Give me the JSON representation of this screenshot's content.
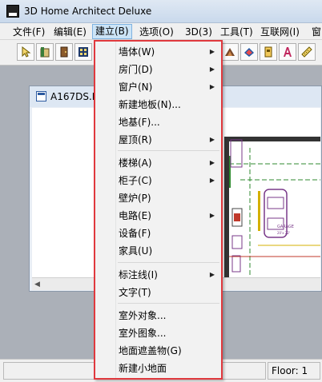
{
  "window": {
    "title": "3D Home Architect Deluxe"
  },
  "menubar": {
    "items": [
      "文件(F)",
      "编辑(E)",
      "建立(B)",
      "选项(O)",
      "3D(3)",
      "工具(T)",
      "互联网(I)",
      "窗"
    ]
  },
  "toolbar": {
    "icons": [
      "pointer-icon",
      "wall-icon",
      "door-icon",
      "window-icon",
      "roof-icon",
      "material-icon",
      "camera-icon",
      "text-icon",
      "ruler-icon"
    ]
  },
  "document": {
    "title": "A167DS.D",
    "plan_labels": {
      "garage": "GARAGE",
      "garage_size": "20'x 22'"
    }
  },
  "build_menu": {
    "items": [
      {
        "label": "墙体(W)",
        "submenu": true
      },
      {
        "label": "房门(D)",
        "submenu": true
      },
      {
        "label": "窗户(N)",
        "submenu": true
      },
      {
        "label": "新建地板(N)...",
        "submenu": false
      },
      {
        "label": "地基(F)...",
        "submenu": false
      },
      {
        "label": "屋顶(R)",
        "submenu": true
      },
      {
        "label": "楼梯(A)",
        "submenu": true
      },
      {
        "label": "柜子(C)",
        "submenu": true
      },
      {
        "label": "壁炉(P)",
        "submenu": false
      },
      {
        "label": "电路(E)",
        "submenu": true
      },
      {
        "label": "设备(F)",
        "submenu": false
      },
      {
        "label": "家具(U)",
        "submenu": false
      },
      {
        "label": "标注线(I)",
        "submenu": true
      },
      {
        "label": "文字(T)",
        "submenu": false
      },
      {
        "label": "室外对象...",
        "submenu": false
      },
      {
        "label": "室外图象...",
        "submenu": false
      },
      {
        "label": "地面遮盖物(G)",
        "submenu": false
      },
      {
        "label": "新建小地面",
        "submenu": false
      }
    ]
  },
  "statusbar": {
    "floor": "Floor: 1"
  },
  "colors": {
    "menu_highlight_border": "#e0393e",
    "active_menu_bg": "#cce4f7"
  }
}
